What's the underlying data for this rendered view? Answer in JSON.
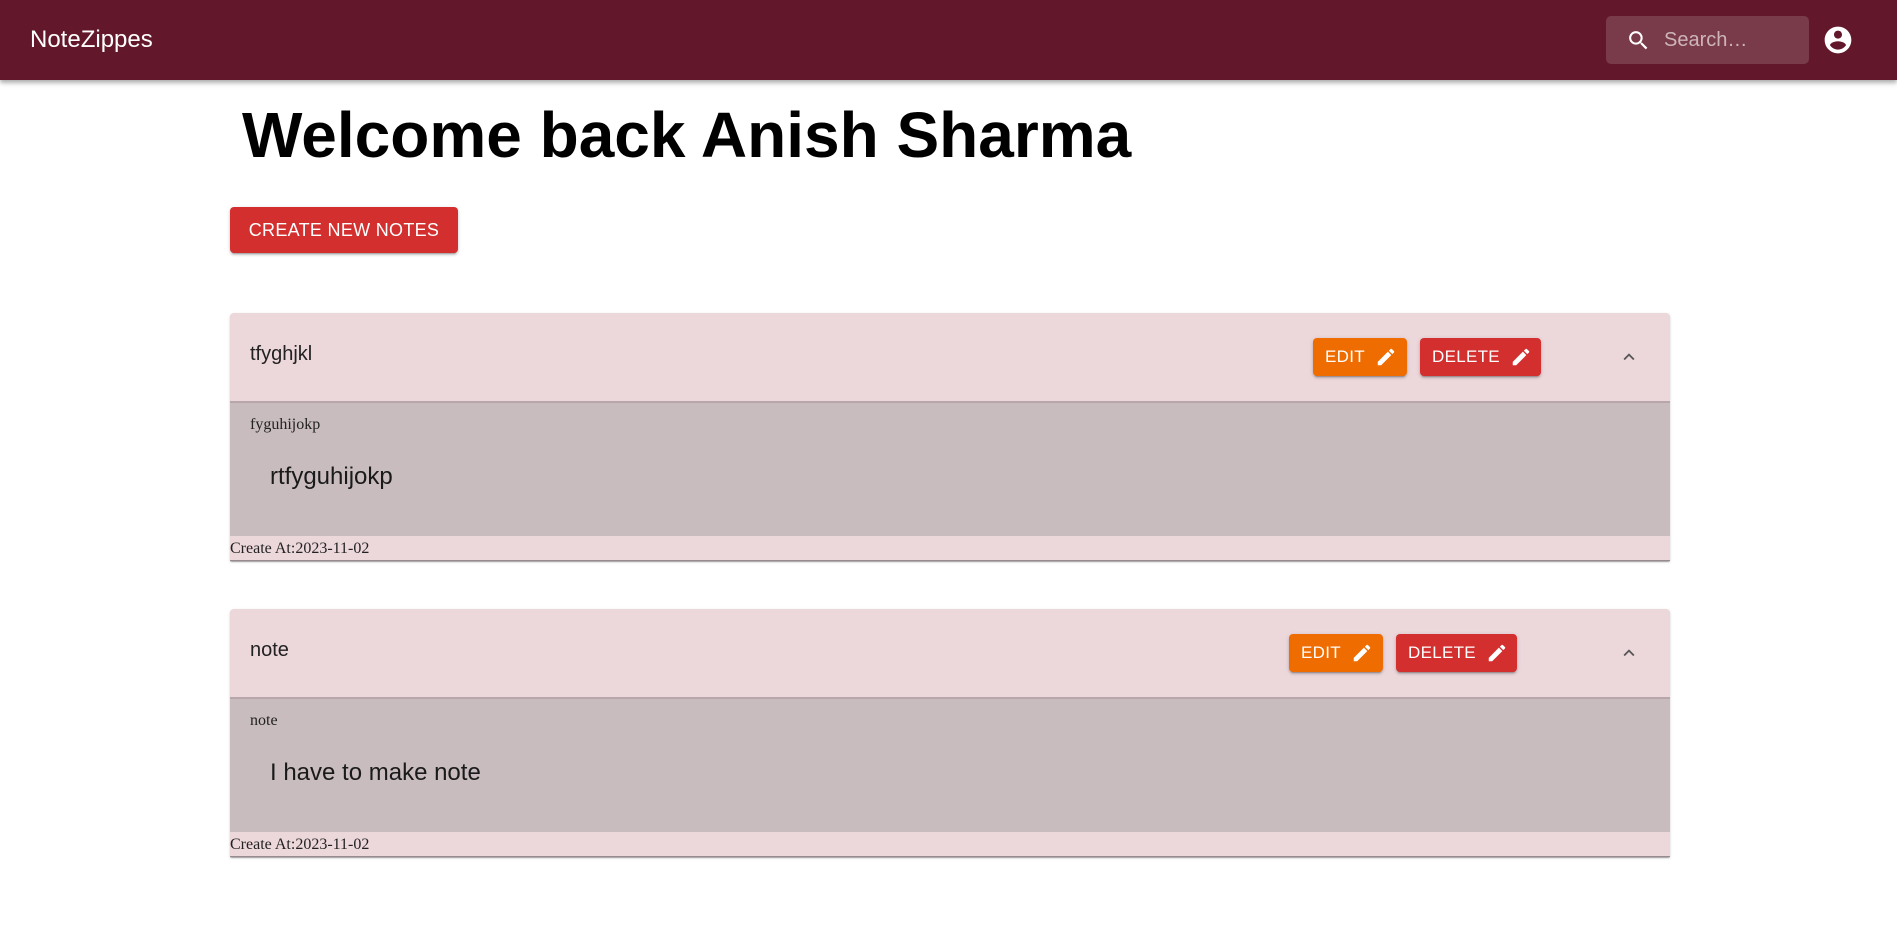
{
  "app": {
    "brand": "NoteZippes",
    "search_placeholder": "Search…",
    "primary_color": "#62182a"
  },
  "page": {
    "welcome": "Welcome back Anish Sharma",
    "create_button": "CREATE NEW NOTES"
  },
  "notes": [
    {
      "title": "tfyghjkl",
      "category": "fyguhijokp",
      "content": "rtfyguhijokp",
      "created": "Create At:2023-11-02",
      "edit_label": "EDIT",
      "delete_label": "DELETE"
    },
    {
      "title": "note",
      "category": "note",
      "content": "I have to make note",
      "created": "Create At:2023-11-02",
      "edit_label": "EDIT",
      "delete_label": "DELETE"
    }
  ],
  "colors": {
    "card_header": "#ecd7db",
    "card_body": "#c8bcbe",
    "edit": "#ef6c00",
    "delete": "#d32f2f"
  },
  "icons": [
    "search-icon",
    "account-circle-icon",
    "pencil-icon",
    "chevron-up-icon"
  ]
}
